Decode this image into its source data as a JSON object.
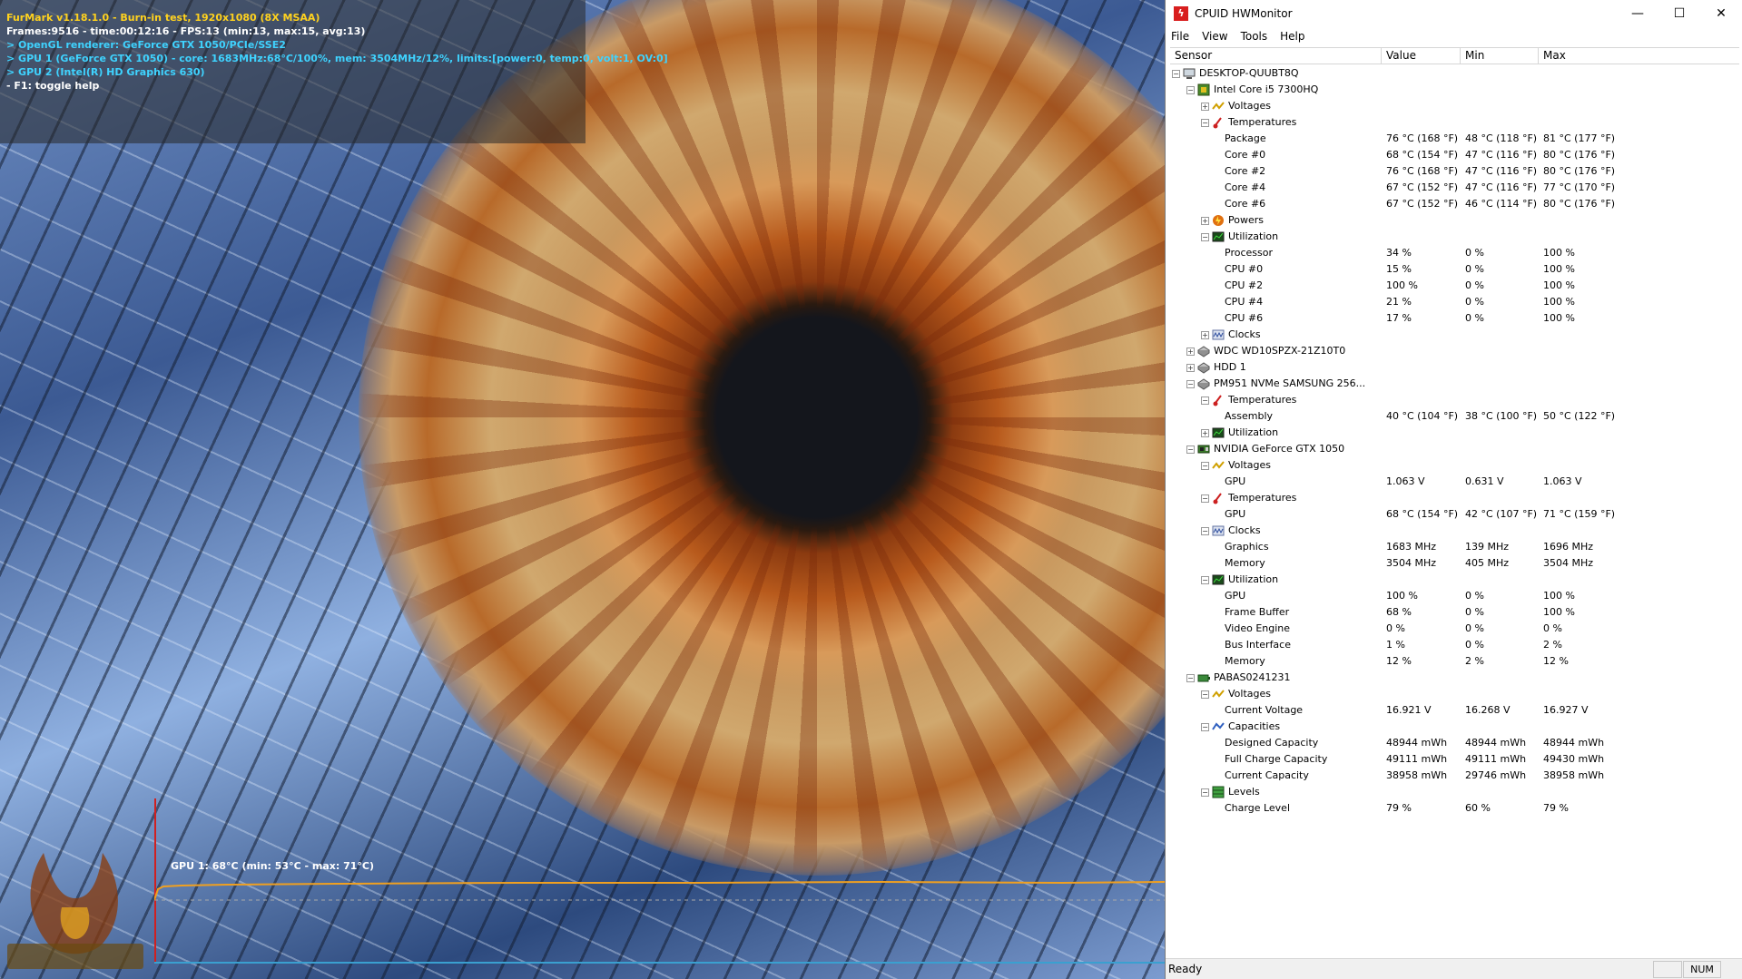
{
  "furmark": {
    "lines": [
      {
        "text": "FurMark v1.18.1.0 - Burn-in test, 1920x1080 (8X MSAA)",
        "color": "#ffd21e"
      },
      {
        "text": "Frames:9516 - time:00:12:16 - FPS:13 (min:13, max:15, avg:13)",
        "color": "#ffffff"
      },
      {
        "text": "> OpenGL renderer: GeForce GTX 1050/PCIe/SSE2",
        "color": "#3fd3ff"
      },
      {
        "text": "> GPU 1 (GeForce GTX 1050) - core: 1683MHz:68°C/100%, mem: 3504MHz/12%, limits:[power:0, temp:0, volt:1, OV:0]",
        "color": "#3fd3ff"
      },
      {
        "text": "> GPU 2 (Intel(R) HD Graphics 630)",
        "color": "#3fd3ff"
      },
      {
        "text": "- F1: toggle help",
        "color": "#ffffff"
      }
    ],
    "graph_label": "GPU 1: 68°C (min: 53°C - max: 71°C)",
    "graph_color": "#f0a020"
  },
  "hwmonitor": {
    "title": "CPUID HWMonitor",
    "window_buttons": [
      "—",
      "☐",
      "✕"
    ],
    "menu": [
      "File",
      "View",
      "Tools",
      "Help"
    ],
    "columns": [
      "Sensor",
      "Value",
      "Min",
      "Max"
    ],
    "status": "Ready",
    "num": "NUM",
    "rows": [
      {
        "level": 0,
        "exp": "−",
        "icon": "computer-icon",
        "name": "DESKTOP-QUUBT8Q"
      },
      {
        "level": 1,
        "exp": "−",
        "icon": "cpu-icon",
        "name": "Intel Core i5 7300HQ"
      },
      {
        "level": 2,
        "exp": "+",
        "icon": "voltage-icon",
        "name": "Voltages"
      },
      {
        "level": 2,
        "exp": "−",
        "icon": "thermometer-icon",
        "name": "Temperatures"
      },
      {
        "level": 3,
        "name": "Package",
        "value": "76 °C  (168 °F)",
        "min": "48 °C  (118 °F)",
        "max": "81 °C  (177 °F)"
      },
      {
        "level": 3,
        "name": "Core #0",
        "value": "68 °C  (154 °F)",
        "min": "47 °C  (116 °F)",
        "max": "80 °C  (176 °F)"
      },
      {
        "level": 3,
        "name": "Core #2",
        "value": "76 °C  (168 °F)",
        "min": "47 °C  (116 °F)",
        "max": "80 °C  (176 °F)"
      },
      {
        "level": 3,
        "name": "Core #4",
        "value": "67 °C  (152 °F)",
        "min": "47 °C  (116 °F)",
        "max": "77 °C  (170 °F)"
      },
      {
        "level": 3,
        "name": "Core #6",
        "value": "67 °C  (152 °F)",
        "min": "46 °C  (114 °F)",
        "max": "80 °C  (176 °F)"
      },
      {
        "level": 2,
        "exp": "+",
        "icon": "power-icon",
        "name": "Powers"
      },
      {
        "level": 2,
        "exp": "−",
        "icon": "utilization-icon",
        "name": "Utilization"
      },
      {
        "level": 3,
        "name": "Processor",
        "value": "34 %",
        "min": "0 %",
        "max": "100 %"
      },
      {
        "level": 3,
        "name": "CPU #0",
        "value": "15 %",
        "min": "0 %",
        "max": "100 %"
      },
      {
        "level": 3,
        "name": "CPU #2",
        "value": "100 %",
        "min": "0 %",
        "max": "100 %"
      },
      {
        "level": 3,
        "name": "CPU #4",
        "value": "21 %",
        "min": "0 %",
        "max": "100 %"
      },
      {
        "level": 3,
        "name": "CPU #6",
        "value": "17 %",
        "min": "0 %",
        "max": "100 %"
      },
      {
        "level": 2,
        "exp": "+",
        "icon": "clock-icon",
        "name": "Clocks"
      },
      {
        "level": 1,
        "exp": "+",
        "icon": "drive-icon",
        "name": "WDC WD10SPZX-21Z10T0"
      },
      {
        "level": 1,
        "exp": "+",
        "icon": "drive-icon",
        "name": "HDD 1"
      },
      {
        "level": 1,
        "exp": "−",
        "icon": "drive-icon",
        "name": "PM951 NVMe SAMSUNG 256..."
      },
      {
        "level": 2,
        "exp": "−",
        "icon": "thermometer-icon",
        "name": "Temperatures"
      },
      {
        "level": 3,
        "name": "Assembly",
        "value": "40 °C  (104 °F)",
        "min": "38 °C  (100 °F)",
        "max": "50 °C  (122 °F)"
      },
      {
        "level": 2,
        "exp": "+",
        "icon": "utilization-icon",
        "name": "Utilization"
      },
      {
        "level": 1,
        "exp": "−",
        "icon": "gpu-icon",
        "name": "NVIDIA GeForce GTX 1050"
      },
      {
        "level": 2,
        "exp": "−",
        "icon": "voltage-icon",
        "name": "Voltages"
      },
      {
        "level": 3,
        "name": "GPU",
        "value": "1.063 V",
        "min": "0.631 V",
        "max": "1.063 V"
      },
      {
        "level": 2,
        "exp": "−",
        "icon": "thermometer-icon",
        "name": "Temperatures"
      },
      {
        "level": 3,
        "name": "GPU",
        "value": "68 °C  (154 °F)",
        "min": "42 °C  (107 °F)",
        "max": "71 °C  (159 °F)"
      },
      {
        "level": 2,
        "exp": "−",
        "icon": "clock-icon",
        "name": "Clocks"
      },
      {
        "level": 3,
        "name": "Graphics",
        "value": "1683 MHz",
        "min": "139 MHz",
        "max": "1696 MHz"
      },
      {
        "level": 3,
        "name": "Memory",
        "value": "3504 MHz",
        "min": "405 MHz",
        "max": "3504 MHz"
      },
      {
        "level": 2,
        "exp": "−",
        "icon": "utilization-icon",
        "name": "Utilization"
      },
      {
        "level": 3,
        "name": "GPU",
        "value": "100 %",
        "min": "0 %",
        "max": "100 %"
      },
      {
        "level": 3,
        "name": "Frame Buffer",
        "value": "68 %",
        "min": "0 %",
        "max": "100 %"
      },
      {
        "level": 3,
        "name": "Video Engine",
        "value": "0 %",
        "min": "0 %",
        "max": "0 %"
      },
      {
        "level": 3,
        "name": "Bus Interface",
        "value": "1 %",
        "min": "0 %",
        "max": "2 %"
      },
      {
        "level": 3,
        "name": "Memory",
        "value": "12 %",
        "min": "2 %",
        "max": "12 %"
      },
      {
        "level": 1,
        "exp": "−",
        "icon": "battery-icon",
        "name": "PABAS0241231"
      },
      {
        "level": 2,
        "exp": "−",
        "icon": "voltage-icon",
        "name": "Voltages"
      },
      {
        "level": 3,
        "name": "Current Voltage",
        "value": "16.921 V",
        "min": "16.268 V",
        "max": "16.927 V"
      },
      {
        "level": 2,
        "exp": "−",
        "icon": "capacity-icon",
        "name": "Capacities"
      },
      {
        "level": 3,
        "name": "Designed Capacity",
        "value": "48944 mWh",
        "min": "48944 mWh",
        "max": "48944 mWh"
      },
      {
        "level": 3,
        "name": "Full Charge Capacity",
        "value": "49111 mWh",
        "min": "49111 mWh",
        "max": "49430 mWh"
      },
      {
        "level": 3,
        "name": "Current Capacity",
        "value": "38958 mWh",
        "min": "29746 mWh",
        "max": "38958 mWh"
      },
      {
        "level": 2,
        "exp": "−",
        "icon": "levels-icon",
        "name": "Levels"
      },
      {
        "level": 3,
        "name": "Charge Level",
        "value": "79 %",
        "min": "60 %",
        "max": "79 %"
      }
    ]
  }
}
